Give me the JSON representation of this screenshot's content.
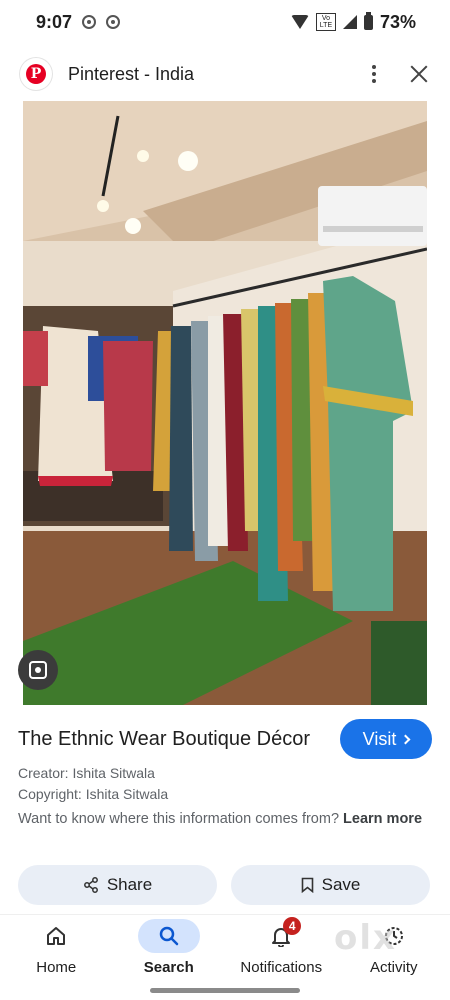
{
  "status_bar": {
    "time": "9:07",
    "network_label": "Vo LTE",
    "battery": "73%"
  },
  "header": {
    "title": "Pinterest - India",
    "logo_letter": "P",
    "menu_icon": "more-vert-icon",
    "close_icon": "close-icon"
  },
  "image": {
    "subject": "boutique-interior-with-clothing-racks"
  },
  "result": {
    "title": "The Ethnic Wear Boutique Décor",
    "visit_label": "Visit",
    "creator": "Creator: Ishita Sitwala",
    "copyright": "Copyright: Ishita Sitwala",
    "question": "Want to know where this information comes from?",
    "learn_more": "Learn more"
  },
  "actions": {
    "share_label": "Share",
    "save_label": "Save"
  },
  "nav": {
    "items": [
      {
        "label": "Home",
        "icon": "home-icon"
      },
      {
        "label": "Search",
        "icon": "search-icon",
        "active": true
      },
      {
        "label": "Notifications",
        "icon": "bell-icon",
        "badge": "4"
      },
      {
        "label": "Activity",
        "icon": "activity-icon"
      }
    ]
  },
  "watermark": "olx",
  "colors": {
    "accent": "#1a73e8",
    "pinterest_red": "#e60023",
    "badge_red": "#c5221f"
  }
}
